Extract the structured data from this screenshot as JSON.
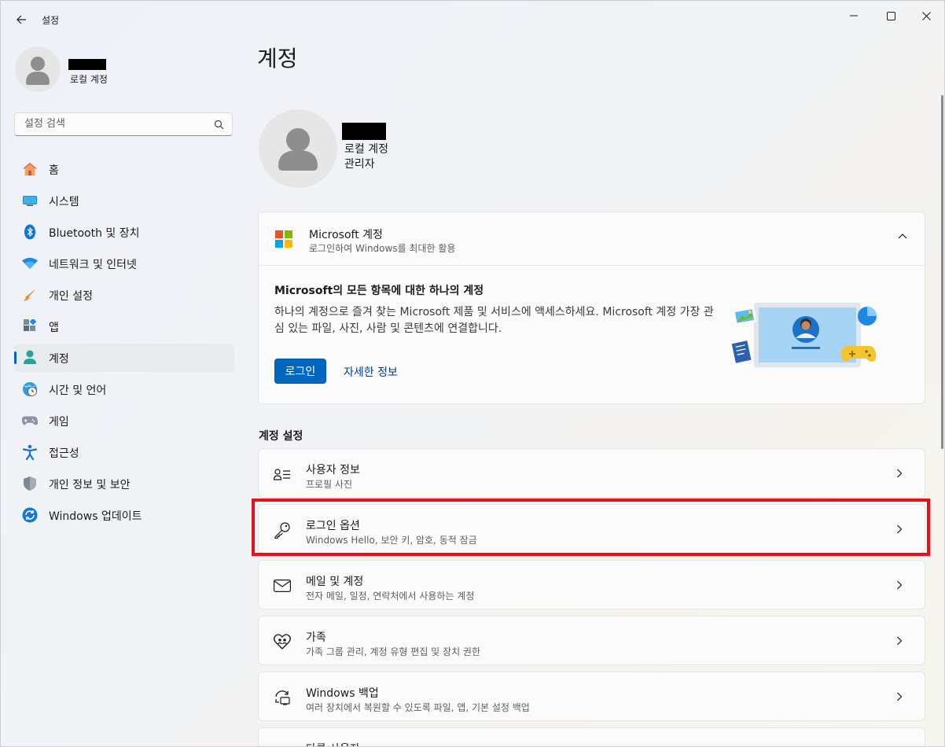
{
  "window": {
    "title": "설정",
    "controls": {
      "minimize": "minimize-icon",
      "maximize": "maximize-icon",
      "close": "close-icon"
    }
  },
  "sidebar": {
    "account_type": "로컬 계정",
    "search": {
      "placeholder": "설정 검색",
      "value": ""
    },
    "items": [
      {
        "label": "홈",
        "icon": "home-icon"
      },
      {
        "label": "시스템",
        "icon": "system-icon"
      },
      {
        "label": "Bluetooth 및 장치",
        "icon": "bluetooth-icon"
      },
      {
        "label": "네트워크 및 인터넷",
        "icon": "wifi-icon"
      },
      {
        "label": "개인 설정",
        "icon": "brush-icon"
      },
      {
        "label": "앱",
        "icon": "apps-icon"
      },
      {
        "label": "계정",
        "icon": "account-icon",
        "selected": true
      },
      {
        "label": "시간 및 언어",
        "icon": "globe-clock-icon"
      },
      {
        "label": "게임",
        "icon": "gamepad-icon"
      },
      {
        "label": "접근성",
        "icon": "accessibility-icon"
      },
      {
        "label": "개인 정보 및 보안",
        "icon": "shield-icon"
      },
      {
        "label": "Windows 업데이트",
        "icon": "update-icon"
      }
    ]
  },
  "main": {
    "title": "계정",
    "user": {
      "account_type": "로컬 계정",
      "role": "관리자"
    },
    "ms_account": {
      "title": "Microsoft 계정",
      "subtitle": "로그인하여 Windows를 최대한 활용",
      "heading": "Microsoft의 모든 항목에 대한 하나의 계정",
      "description": "하나의 계정으로 즐겨 찾는 Microsoft 제품 및 서비스에 액세스하세요. Microsoft 계정 가장 관심 있는 파일, 사진, 사람 및 콘텐츠에 연결합니다.",
      "login_button": "로그인",
      "more_link": "자세한 정보",
      "colors": {
        "red": "#f25022",
        "green": "#7fba00",
        "blue": "#00a4ef",
        "yellow": "#ffb900"
      }
    },
    "section_title": "계정 설정",
    "settings": [
      {
        "title": "사용자 정보",
        "subtitle": "프로필 사진",
        "icon": "user-info-icon"
      },
      {
        "title": "로그인 옵션",
        "subtitle": "Windows Hello, 보안 키, 암호, 동적 잠금",
        "icon": "key-icon",
        "highlighted": true
      },
      {
        "title": "메일 및 계정",
        "subtitle": "전자 메일, 일정, 연락처에서 사용하는 계정",
        "icon": "mail-icon"
      },
      {
        "title": "가족",
        "subtitle": "가족 그룹 관리, 계정 유형 편집 및 장치 권한",
        "icon": "family-heart-icon"
      },
      {
        "title": "Windows 백업",
        "subtitle": "여러 장치에서 복원할 수 있도록 파일, 앱, 기본 설정 백업",
        "icon": "backup-icon"
      },
      {
        "title": "다른 사용자",
        "subtitle": "",
        "icon": "other-users-icon"
      }
    ]
  },
  "accent": "#0067c0",
  "highlight_color": "#e3121c"
}
